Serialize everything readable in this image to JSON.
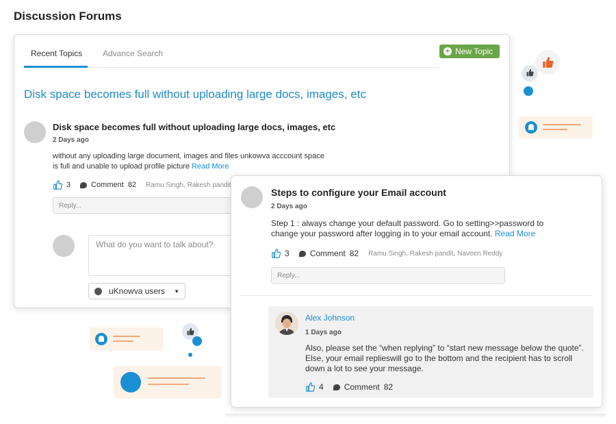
{
  "page_title": "Discussion Forums",
  "tabs": [
    {
      "label": "Recent Topics",
      "active": true
    },
    {
      "label": "Advance Search",
      "active": false
    }
  ],
  "new_topic_label": "New Topic",
  "headline": "Disk space becomes full without uploading large docs, images, etc",
  "post1": {
    "title": "Disk space becomes full without uploading large docs, images, etc",
    "date": "2 Days ago",
    "body": "without any uploading large document, images and files unkowva acccount space is full and unable to upload profile picture",
    "read_more": "Read More",
    "likes": "3",
    "comment_label": "Comment",
    "comments": "82",
    "names": "Ramu Singh, Rakesh pandit",
    "reply_placeholder": "Reply..."
  },
  "composer": {
    "placeholder": "What do you want to talk about?",
    "audience": "uKnowva users"
  },
  "post2": {
    "title": "Steps to configure your Email account",
    "date": "2 Days ago",
    "body": "Step 1 : always change your default password. Go to setting>>password to change your password after logging in to your email account.",
    "read_more": "Read More",
    "likes": "3",
    "comment_label": "Comment",
    "comments": "82",
    "names": "Ramu Singh, Rakesh pandit, Naveen Reddy",
    "reply_placeholder": "Reply..."
  },
  "reply": {
    "author": "Alex Johnson",
    "date": "1 Days ago",
    "body": "Also, please set the “when replying” to “start new message below the quote”. Else, your email replieswill go to the bottom and the recipient has to scroll down a lot to see your message.",
    "likes": "4",
    "comment_label": "Comment",
    "comments": "82"
  },
  "colors": {
    "accent": "#1a8fd1",
    "new_topic_bg": "#6aa548",
    "decor_orange": "#f0a878",
    "thumb_orange": "#e8632a"
  }
}
